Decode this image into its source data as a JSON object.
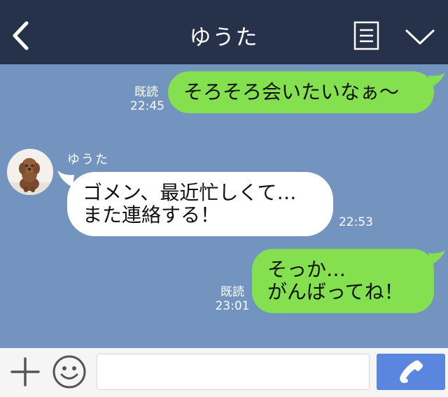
{
  "header": {
    "title": "ゆうた"
  },
  "messages": [
    {
      "from": "me",
      "text": "そろそろ会いたいなぁ〜",
      "read_label": "既読",
      "time": "22:45"
    },
    {
      "from": "other",
      "sender": "ゆうた",
      "lines": [
        "ゴメン、最近忙しくて…",
        "また連絡する！"
      ],
      "time": "22:53"
    },
    {
      "from": "me",
      "lines": [
        "そっか…",
        "がんばってね！"
      ],
      "read_label": "既読",
      "time": "23:01"
    }
  ],
  "input": {
    "placeholder": "",
    "value": ""
  },
  "colors": {
    "header_bg": "#253249",
    "chat_bg": "#7494c0",
    "my_bubble": "#84e04e",
    "their_bubble": "#ffffff",
    "call_button": "#5b86e0"
  },
  "icons": [
    "back-arrow-icon",
    "menu-icon",
    "chevron-down-icon",
    "plus-icon",
    "emoji-icon",
    "phone-icon"
  ]
}
